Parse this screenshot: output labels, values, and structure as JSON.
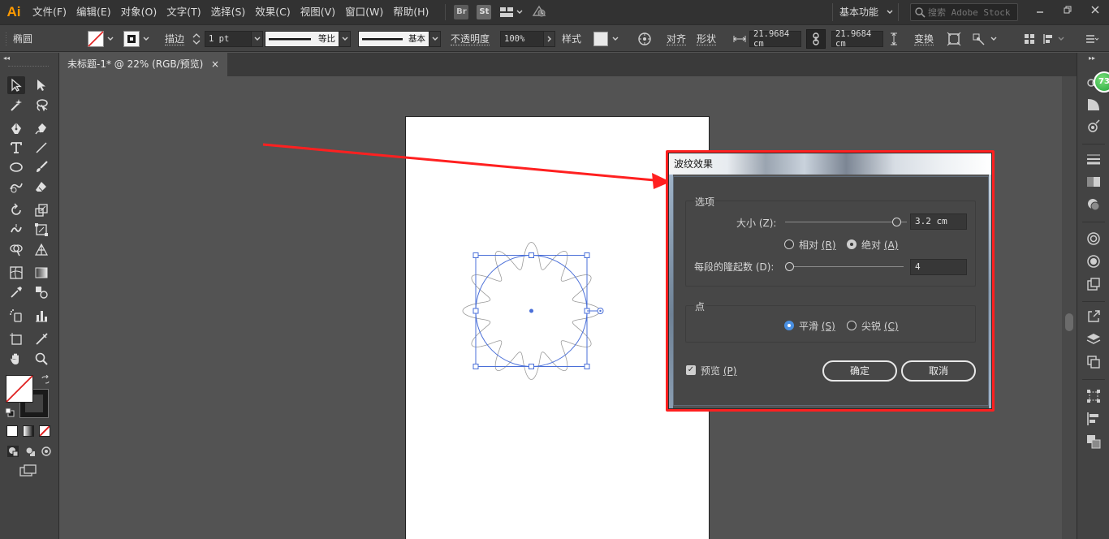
{
  "app": {
    "logo": "Ai"
  },
  "menu": [
    "文件(F)",
    "编辑(E)",
    "对象(O)",
    "文字(T)",
    "选择(S)",
    "效果(C)",
    "视图(V)",
    "窗口(W)",
    "帮助(H)"
  ],
  "menu_badges": {
    "bridge": "Br",
    "stock": "St"
  },
  "workspace": {
    "label": "基本功能"
  },
  "search": {
    "placeholder": "搜索 Adobe Stock"
  },
  "controlbar": {
    "object_type": "椭圆",
    "stroke_label": "描边",
    "stroke_value": "1 pt",
    "profile_label": "等比",
    "brush_label": "基本",
    "opacity_label": "不透明度",
    "opacity_value": "100%",
    "style_label": "样式",
    "align_label": "对齐",
    "shape_label": "形状",
    "width_value": "21.9684 cm",
    "height_value": "21.9684 cm",
    "transform_label": "变换"
  },
  "document_tab": {
    "title": "未标题-1* @ 22% (RGB/预览)",
    "close": "×"
  },
  "dock_badge": "73",
  "dialog": {
    "title": "波纹效果",
    "options_group": "选项",
    "size_label": "大小 (Z):",
    "size_value": "3.2 cm",
    "relative_label": "相对",
    "relative_key": "(R)",
    "absolute_label": "绝对",
    "absolute_key": "(A)",
    "ridges_label": "每段的隆起数 (D):",
    "ridges_value": "4",
    "points_group": "点",
    "smooth_label": "平滑",
    "smooth_key": "(S)",
    "corner_label": "尖锐",
    "corner_key": "(C)",
    "preview_label": "预览",
    "preview_key": "(P)",
    "ok_label": "确定",
    "cancel_label": "取消"
  },
  "controls": {
    "size_slider_fraction": 0.92,
    "ridges_slider_fraction": 0.0,
    "relative_selected": false,
    "absolute_selected": true,
    "smooth_selected": true,
    "corner_selected": false,
    "preview_checked": true
  },
  "colors": {
    "accent": "#ff9a00",
    "annotation_red": "#ff2020",
    "selection_blue": "#4a6fd8",
    "radio_blue": "#4a90e2"
  }
}
